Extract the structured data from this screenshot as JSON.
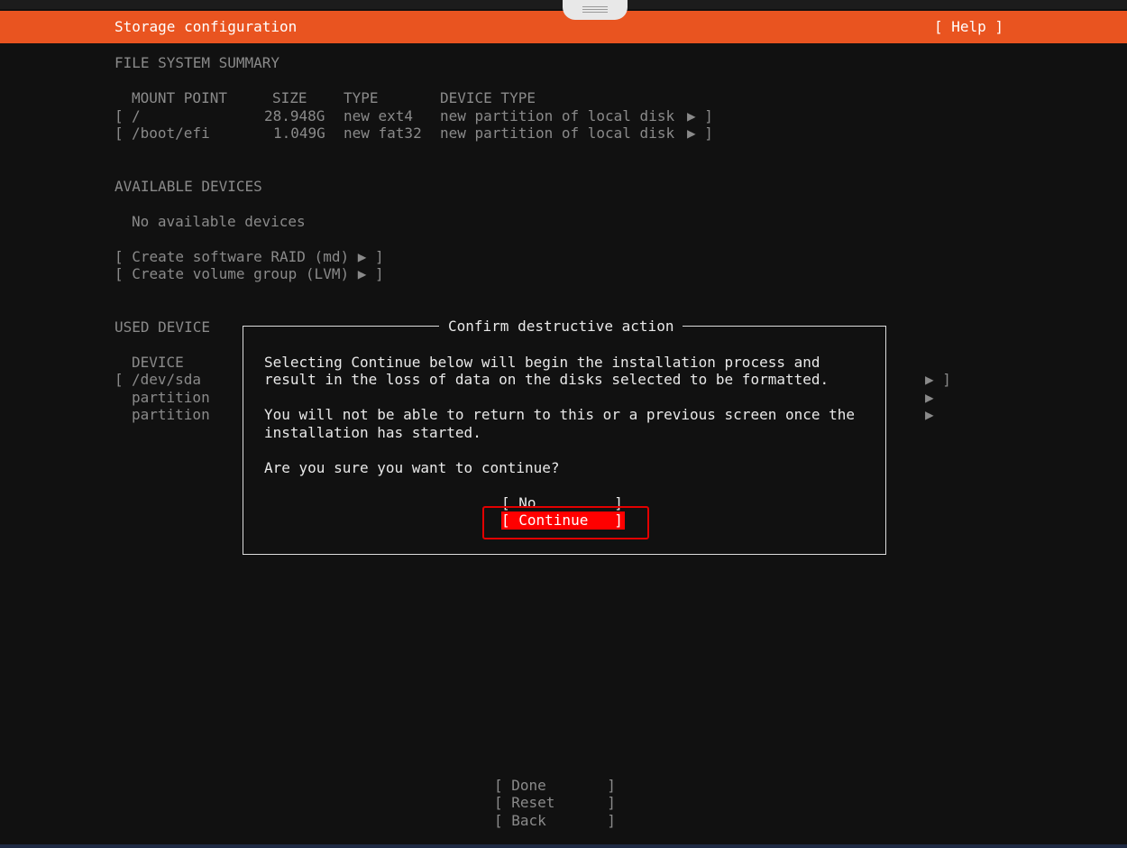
{
  "header": {
    "title": "Storage configuration",
    "help": "[ Help ]"
  },
  "summary": {
    "heading": "FILE SYSTEM SUMMARY",
    "columns": {
      "mount_point": "MOUNT POINT",
      "size": "SIZE",
      "type": "TYPE",
      "device_type": "DEVICE TYPE"
    },
    "rows": [
      {
        "open": "[",
        "mount": "/",
        "size": "28.948G",
        "type": "new ext4",
        "device_type": "new partition of local disk",
        "arrow": "▶ ]"
      },
      {
        "open": "[",
        "mount": "/boot/efi",
        "size": "1.049G",
        "type": "new fat32",
        "device_type": "new partition of local disk",
        "arrow": "▶ ]"
      }
    ]
  },
  "available": {
    "heading": "AVAILABLE DEVICES",
    "empty": "No available devices",
    "actions": [
      "[ Create software RAID (md) ▶ ]",
      "[ Create volume group (LVM) ▶ ]"
    ]
  },
  "used": {
    "heading": "USED DEVICE",
    "column": "DEVICE",
    "rows": [
      {
        "open": "[",
        "label": "/dev/sda",
        "arrow": "▶ ]"
      },
      {
        "open": "",
        "label": "partition",
        "arrow": "▶"
      },
      {
        "open": "",
        "label": "partition",
        "arrow": "▶"
      }
    ]
  },
  "dialog": {
    "title": "Confirm destructive action",
    "lines": [
      "Selecting Continue below will begin the installation process and",
      "result in the loss of data on the disks selected to be formatted.",
      "You will not be able to return to this or a previous screen once the",
      "installation has started.",
      "Are you sure you want to continue?"
    ],
    "no_button": "[ No         ]",
    "continue_button": "[ Continue   ]"
  },
  "footer": {
    "done": "[ Done       ]",
    "reset": "[ Reset      ]",
    "back": "[ Back       ]"
  },
  "colors": {
    "header_bg": "#e95420",
    "focus_bg": "#ff0000",
    "background": "#111111"
  }
}
